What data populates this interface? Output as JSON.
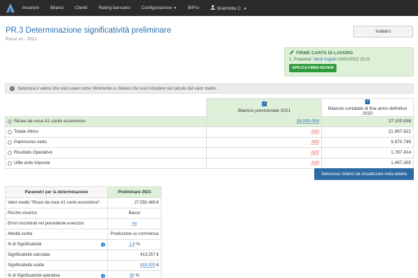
{
  "nav": {
    "items": [
      "Incarichi",
      "Bilanci",
      "Clienti",
      "Rating bancario",
      "Configurazione",
      "BIPro",
      "Brambilla C."
    ]
  },
  "header": {
    "title": "PR.3 Determinazione significatività preliminare",
    "subtitle": "Rossi srl - 2021",
    "back_label": "Indietro"
  },
  "firme": {
    "title": "FIRME CARTA DI LAVORO",
    "prepared_prefix": "1. Prepared:",
    "prepared_name": "Verdi Angelo",
    "prepared_date": "10/01/2022 15:11",
    "apply_label": "APPLICA FIRMA REVIEW"
  },
  "info": {
    "text": "Seleziona il valore che vuoi usare come riferimento e i bilanci che vuoi includere nel calcolo del valor medio."
  },
  "main_table": {
    "col_a": "Bilancio previsionale 2021",
    "col_b": "Bilancio contabile di fine anno definitivo 2020",
    "rows": [
      {
        "label": "Ricavi da voce A1 conto economico",
        "a": "28.000.000",
        "b": "27.100.938"
      },
      {
        "label": "Totale Attivo",
        "a": "N/D",
        "b": "21.897.822"
      },
      {
        "label": "Patrimonio netto",
        "a": "N/D",
        "b": "5.970.799"
      },
      {
        "label": "Risultato Operativo",
        "a": "N/D",
        "b": "1.787.414"
      },
      {
        "label": "Utile ante imposte",
        "a": "N/D",
        "b": "1.497.305"
      }
    ],
    "select_label": "Seleziona i bilanci da visualizzare nella tabella"
  },
  "params": {
    "header_k": "Parametri per la determinazione",
    "header_v": "Preliminare 2021",
    "rows": [
      {
        "k": "Valor medio \"Ricavi da voce A1 conto economico\"",
        "v": "27.550.469 €"
      },
      {
        "k": "Rischio incarico",
        "v": "Basso"
      },
      {
        "k": "Errori riscontrati nel precedente esercizio",
        "v": "no"
      },
      {
        "k": "Attività svolta",
        "v": "Produzione su commessa"
      },
      {
        "k": "% di Significatività",
        "v": "1,5",
        "suffix": "%"
      },
      {
        "k": "Significatività calcolata",
        "v": "413.257 €"
      },
      {
        "k": "Significatività scelta",
        "v": "410.000",
        "suffix": "€"
      },
      {
        "k": "% di Significatività operativa",
        "v": "85",
        "suffix": "%"
      }
    ]
  },
  "colors": {
    "navbar": "#2b2b2b",
    "title_blue": "#2a6fb0",
    "green_bg": "#dff0d8",
    "green_btn": "#2e9a3b",
    "primary_btn": "#2d6ca2",
    "nd_red": "#d9534f"
  }
}
